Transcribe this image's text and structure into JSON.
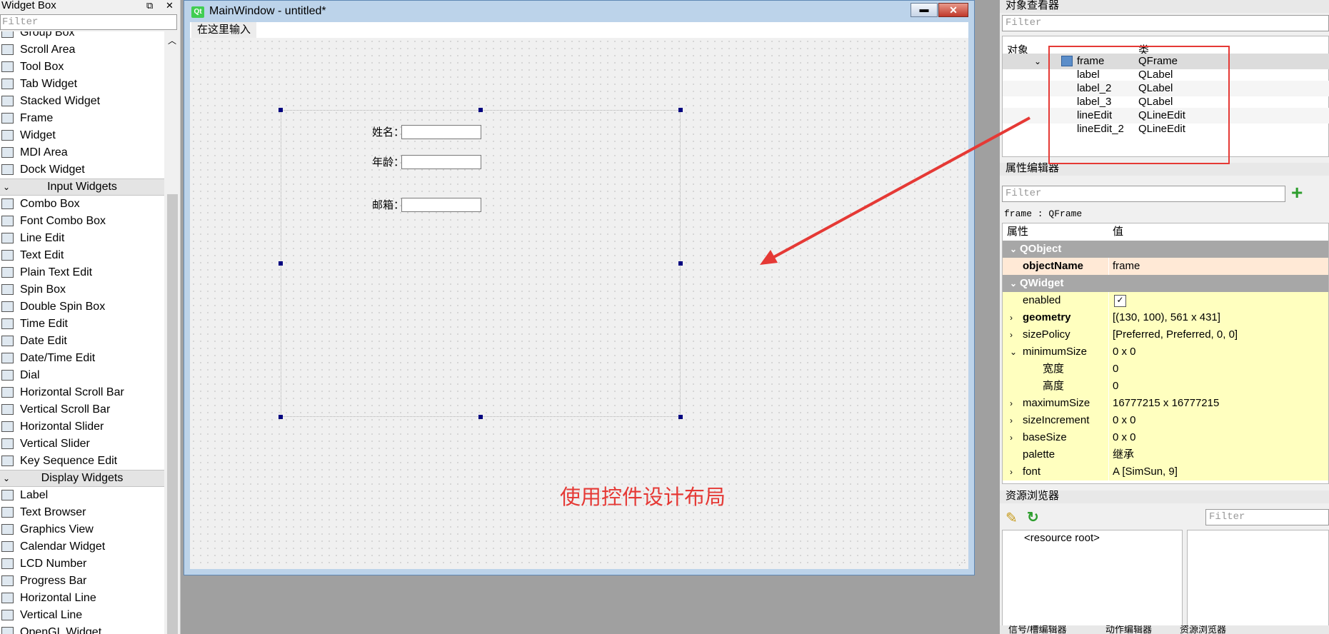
{
  "widget_box": {
    "title": "Widget Box",
    "float_icon": "⧉",
    "close_icon": "✕",
    "filter_placeholder": "Filter",
    "items_a": [
      "Group Box",
      "Scroll Area",
      "Tool Box",
      "Tab Widget",
      "Stacked Widget",
      "Frame",
      "Widget",
      "MDI Area",
      "Dock Widget"
    ],
    "cat_input": "Input Widgets",
    "items_b": [
      "Combo Box",
      "Font Combo Box",
      "Line Edit",
      "Text Edit",
      "Plain Text Edit",
      "Spin Box",
      "Double Spin Box",
      "Time Edit",
      "Date Edit",
      "Date/Time Edit",
      "Dial",
      "Horizontal Scroll Bar",
      "Vertical Scroll Bar",
      "Horizontal Slider",
      "Vertical Slider",
      "Key Sequence Edit"
    ],
    "cat_display": "Display Widgets",
    "items_c": [
      "Label",
      "Text Browser",
      "Graphics View",
      "Calendar Widget",
      "LCD Number",
      "Progress Bar",
      "Horizontal Line",
      "Vertical Line",
      "OpenGL Widget"
    ]
  },
  "main_window": {
    "qt_logo": "Qt",
    "title": "MainWindow - untitled*",
    "minimize": "▬",
    "close": "✕",
    "menu_placeholder": "在这里输入",
    "form": {
      "name_label": "姓名：",
      "age_label": "年龄：",
      "email_label": "邮箱："
    },
    "annotation": "使用控件设计布局"
  },
  "object_inspector": {
    "title": "对象查看器",
    "filter_placeholder": "Filter",
    "col_object": "对象",
    "col_class": "类",
    "rows": [
      {
        "name": "frame",
        "cls": "QFrame"
      },
      {
        "name": "label",
        "cls": "QLabel"
      },
      {
        "name": "label_2",
        "cls": "QLabel"
      },
      {
        "name": "label_3",
        "cls": "QLabel"
      },
      {
        "name": "lineEdit",
        "cls": "QLineEdit"
      },
      {
        "name": "lineEdit_2",
        "cls": "QLineEdit"
      }
    ]
  },
  "property_editor": {
    "title": "属性编辑器",
    "filter_placeholder": "Filter",
    "add_icon": "+",
    "selection": "frame : QFrame",
    "col_prop": "属性",
    "col_value": "值",
    "group_qobject": "QObject",
    "group_qwidget": "QWidget",
    "rows": [
      {
        "k": "objectName",
        "v": "frame"
      },
      {
        "k": "enabled",
        "v": "✓"
      },
      {
        "k": "geometry",
        "v": "[(130, 100), 561 x 431]"
      },
      {
        "k": "sizePolicy",
        "v": "[Preferred, Preferred, 0, 0]"
      },
      {
        "k": "minimumSize",
        "v": "0 x 0"
      },
      {
        "k": "宽度",
        "v": "0"
      },
      {
        "k": "高度",
        "v": "0"
      },
      {
        "k": "maximumSize",
        "v": "16777215 x 16777215"
      },
      {
        "k": "sizeIncrement",
        "v": "0 x 0"
      },
      {
        "k": "baseSize",
        "v": "0 x 0"
      },
      {
        "k": "palette",
        "v": "继承"
      },
      {
        "k": "font",
        "v": "A  [SimSun, 9]"
      }
    ]
  },
  "resource_browser": {
    "title": "资源浏览器",
    "filter_placeholder": "Filter",
    "root": "<resource root>"
  },
  "bottom_tabs": [
    "信号/槽编辑器",
    "动作编辑器",
    "资源浏览器"
  ],
  "colors": {
    "accent_red": "#e53935",
    "group_grey": "#a7a7a7",
    "prop_yellow": "#ffffbf"
  }
}
